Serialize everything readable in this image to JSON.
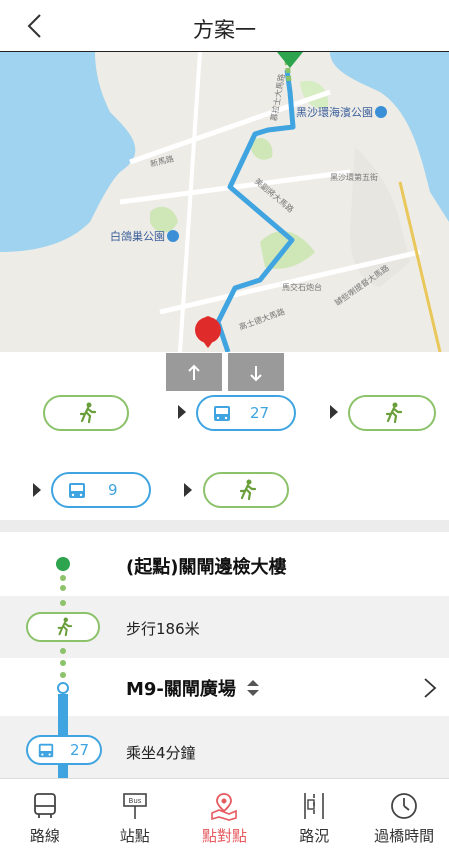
{
  "header": {
    "title": "方案一"
  },
  "map": {
    "labels": {
      "park_east": "黑沙環海濱公園",
      "park_west": "白鴿巢公園",
      "road_1": "慕拉士大馬路",
      "road_2": "黑沙環第五街",
      "road_3": "美副將大馬路",
      "road_4": "馬交石炮台",
      "road_5": "高士德大馬路",
      "road_6": "罅些喇提督大馬路",
      "road_7": "新馬路"
    }
  },
  "segments": {
    "bus_1_number": "27",
    "bus_2_number": "9"
  },
  "steps": {
    "start_title": "(起點)關閘邊檢大樓",
    "walk_text": "步行186米",
    "stop_title": "M9-關閘廣場",
    "ride_bus_number": "27",
    "ride_text": "乘坐4分鐘"
  },
  "nav": [
    {
      "label": "路線",
      "icon": "bus-route-icon"
    },
    {
      "label": "站點",
      "icon": "bus-stop-icon"
    },
    {
      "label": "點對點",
      "icon": "point-to-point-icon"
    },
    {
      "label": "路況",
      "icon": "traffic-icon"
    },
    {
      "label": "過橋時間",
      "icon": "clock-icon"
    }
  ],
  "colors": {
    "walk": "#8bc26a",
    "bus": "#3fa4e0",
    "active": "#e65b60",
    "route": "#3fa4e0"
  }
}
